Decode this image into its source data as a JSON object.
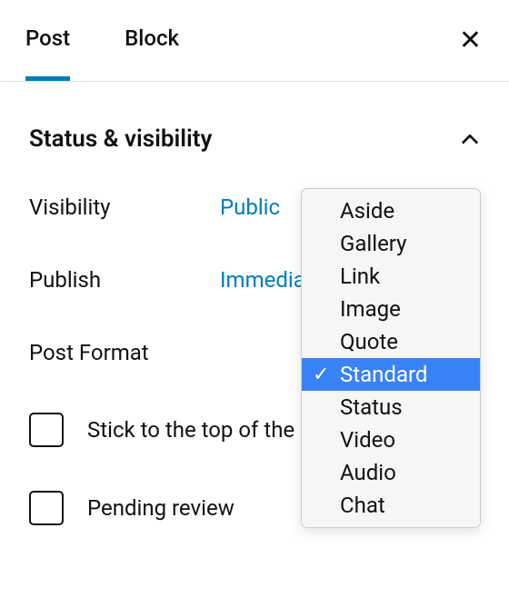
{
  "tabs": {
    "post": "Post",
    "block": "Block"
  },
  "section": {
    "title": "Status & visibility",
    "visibility_label": "Visibility",
    "visibility_value": "Public",
    "publish_label": "Publish",
    "publish_value": "Immediately",
    "format_label": "Post Format"
  },
  "checks": {
    "stick": "Stick to the top of the blog",
    "pending": "Pending review"
  },
  "formats": [
    "Aside",
    "Gallery",
    "Link",
    "Image",
    "Quote",
    "Standard",
    "Status",
    "Video",
    "Audio",
    "Chat"
  ],
  "selected_format": "Standard"
}
